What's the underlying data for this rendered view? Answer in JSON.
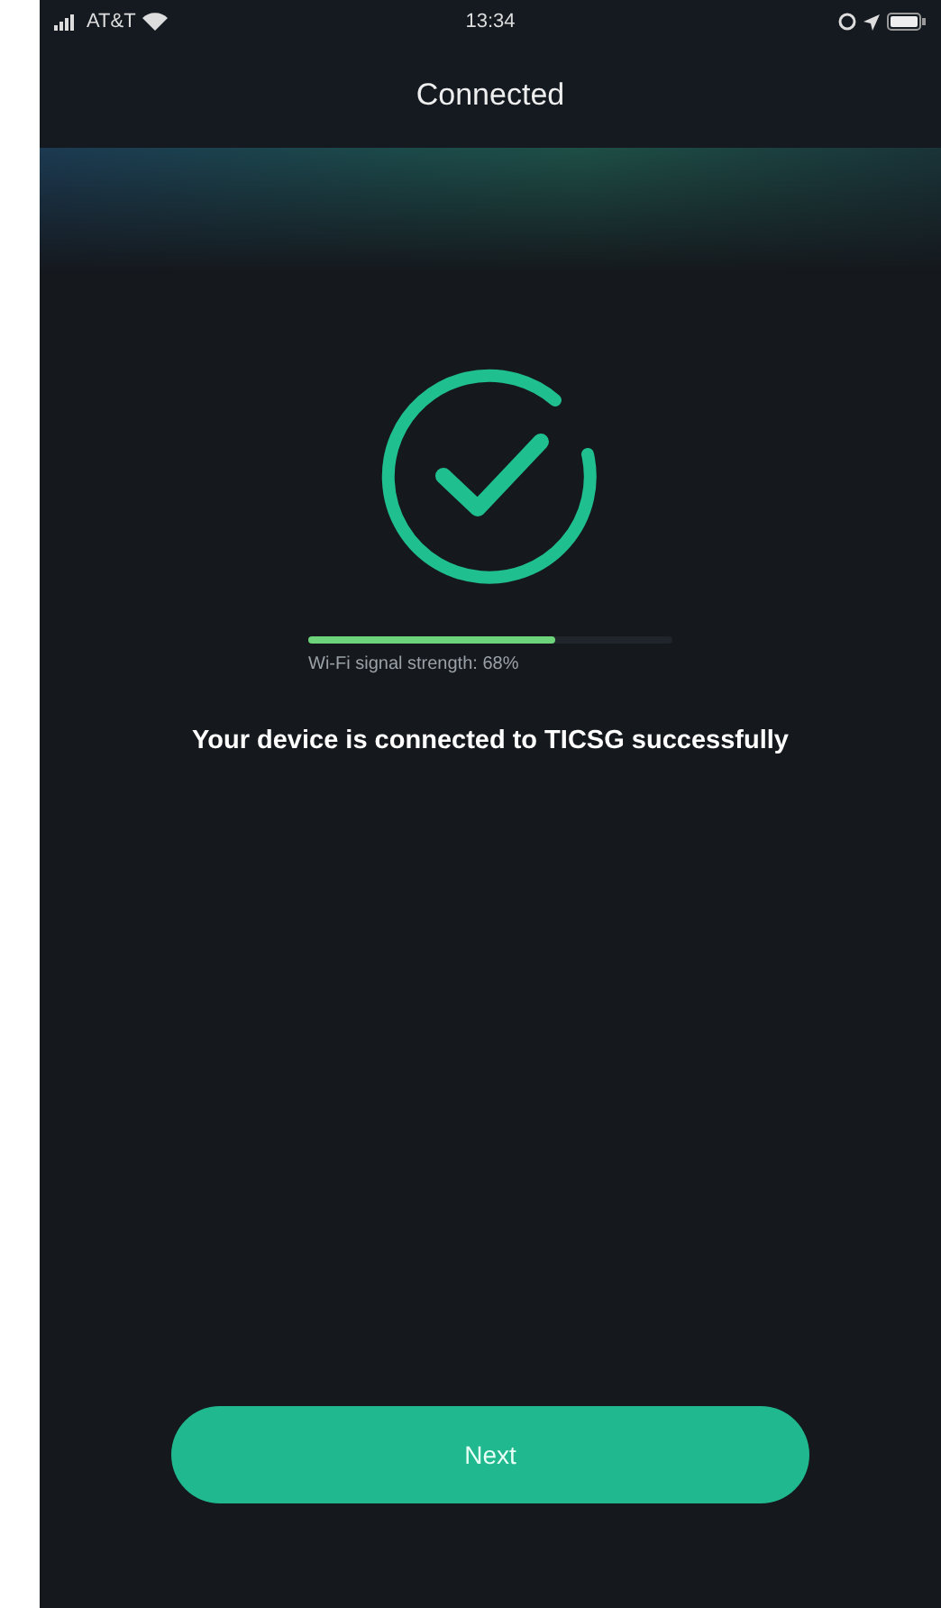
{
  "status_bar": {
    "carrier": "AT&T",
    "time": "13:34"
  },
  "title": "Connected",
  "signal": {
    "level": 0.68,
    "label": "Wi-Fi signal strength: 68%"
  },
  "message": "Your device is connected to TICSG successfully",
  "buttons": [
    {
      "label": "Next"
    }
  ]
}
